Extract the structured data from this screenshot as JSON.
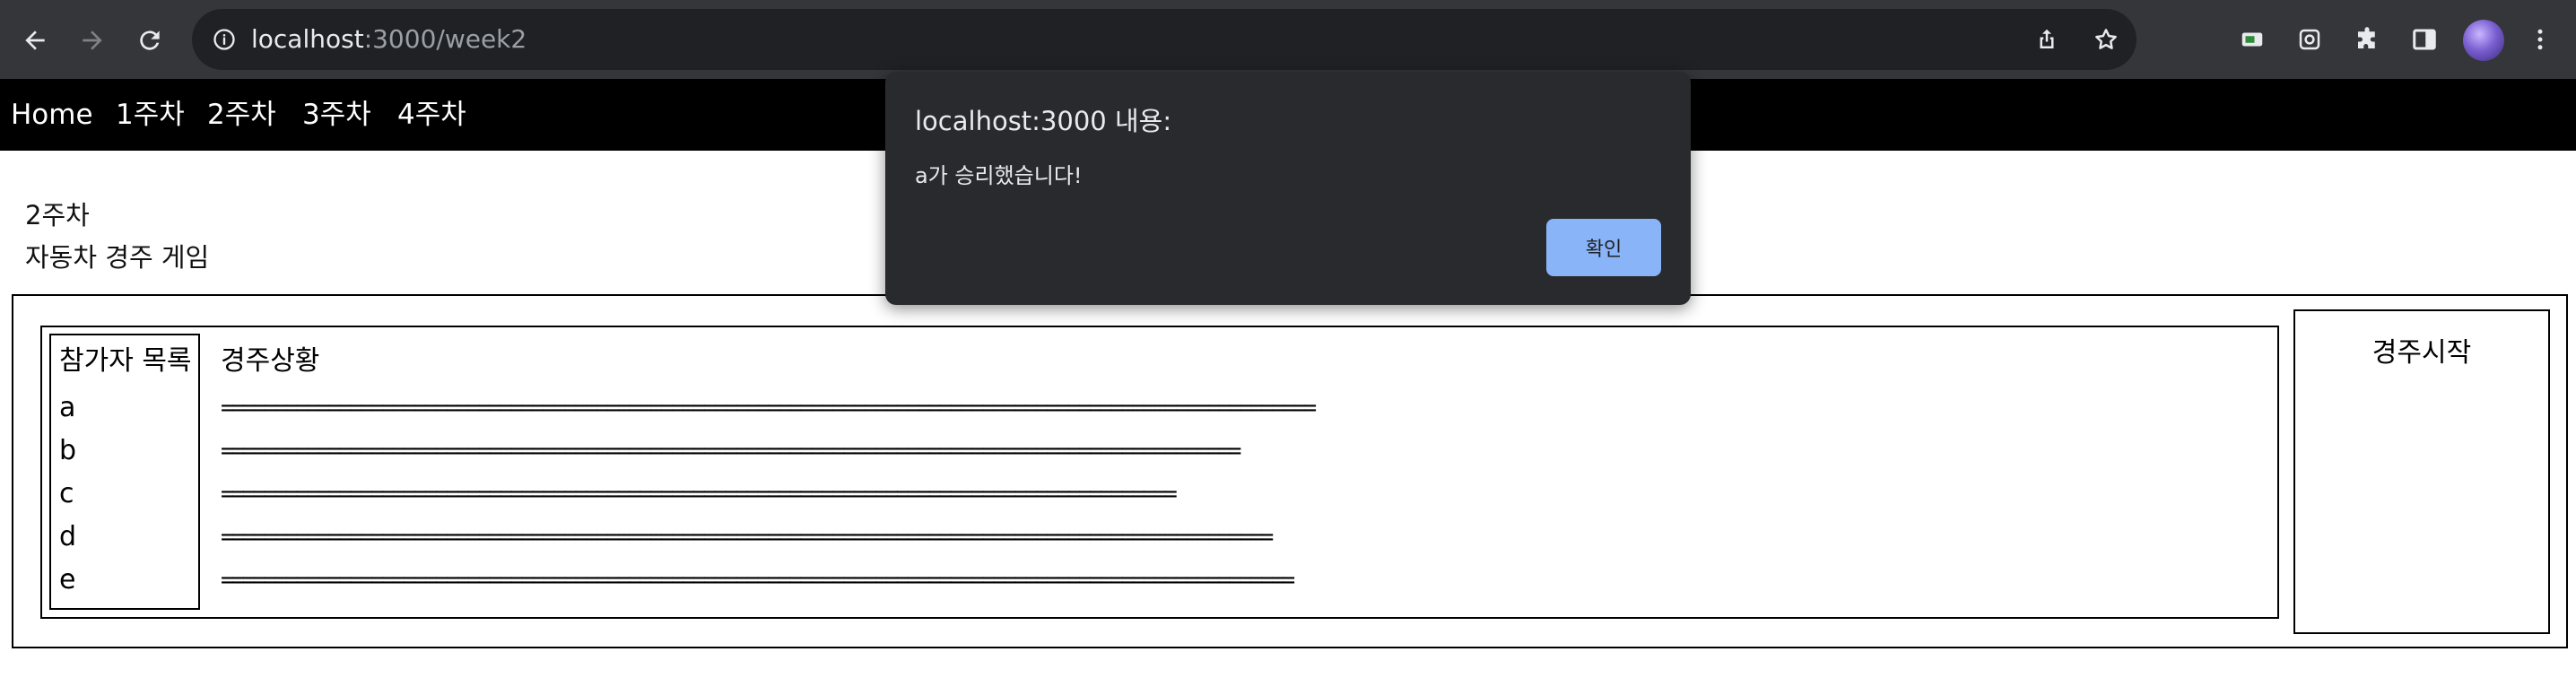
{
  "browser": {
    "url_host": "localhost",
    "url_path": ":3000/week2",
    "icons": [
      "back-icon",
      "forward-icon",
      "reload-icon",
      "site-info-icon",
      "share-icon",
      "bookmark-star-icon",
      "extension-green-icon",
      "extension-box-icon",
      "puzzle-icon",
      "side-panel-icon",
      "avatar",
      "more-menu-icon"
    ]
  },
  "nav": {
    "items": [
      {
        "label": "Home"
      },
      {
        "label": "1주차"
      },
      {
        "label": "2주차"
      },
      {
        "label": "3주차"
      },
      {
        "label": "4주차"
      }
    ]
  },
  "page": {
    "week_title": "2주차",
    "game_title": "자동차 경주 게임",
    "participants_header": "참가자 목록",
    "race_header": "경주상황",
    "start_button_label": "경주시작",
    "participants": [
      "a",
      "b",
      "c",
      "d",
      "e"
    ],
    "race_progress": [
      {
        "name": "a",
        "track": "======================================================================================================"
      },
      {
        "name": "b",
        "track": "==============================================================================================="
      },
      {
        "name": "c",
        "track": "========================================================================================="
      },
      {
        "name": "d",
        "track": "=================================================================================================="
      },
      {
        "name": "e",
        "track": "===================================================================================================="
      }
    ]
  },
  "dialog": {
    "title": "localhost:3000 내용:",
    "message": "a가 승리했습니다!",
    "ok_label": "확인"
  },
  "colors": {
    "chrome_bg": "#35363a",
    "omnibox_bg": "#202124",
    "nav_bg": "#000000",
    "dialog_bg": "#292a2d",
    "dialog_button": "#8ab4f8"
  }
}
